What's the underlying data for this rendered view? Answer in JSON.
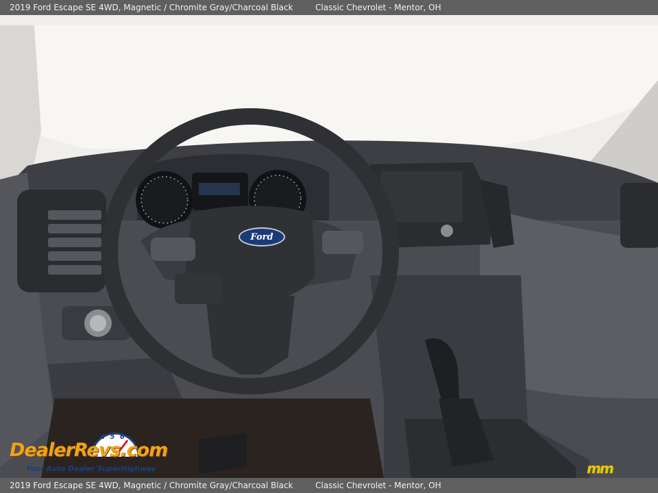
{
  "caption": {
    "vehicle": "2019 Ford Escape SE 4WD,  Magnetic / Chromite Gray/Charcoal Black",
    "dealer": "Classic Chevrolet - Mentor, OH"
  },
  "photo": {
    "steering_badge": "Ford",
    "watermark": {
      "brand": "DealerRevs.com",
      "tagline": "Your Auto Dealer SuperHighway",
      "gauge_digits": "4 5 6",
      "badge": "mm"
    }
  },
  "colors": {
    "caption_bg": "#5f5f5f",
    "caption_text": "#f2f2f2",
    "dash": "#3d3f44",
    "windshield": "#f4f3f0",
    "ford_blue": "#1b3a78",
    "watermark_orange": "#f0a21a",
    "watermark_navy": "#1e3f7a",
    "mm_yellow": "#f4c20d"
  }
}
